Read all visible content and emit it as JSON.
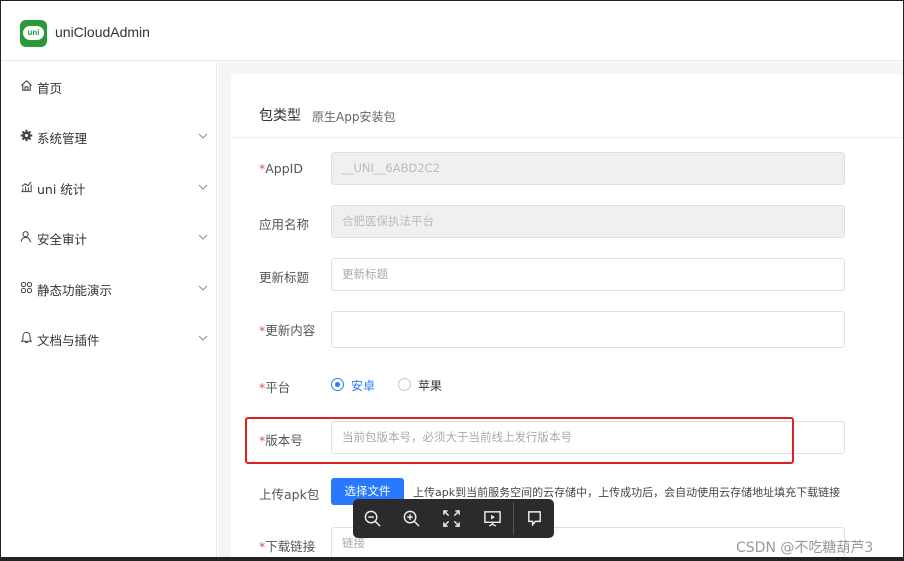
{
  "header": {
    "app_title": "uniCloudAdmin",
    "logo_text": "uni"
  },
  "sidebar": {
    "items": [
      {
        "label": "首页",
        "icon": "home-icon",
        "expandable": false
      },
      {
        "label": "系统管理",
        "icon": "gear-icon",
        "expandable": true
      },
      {
        "label": "uni 统计",
        "icon": "chart-icon",
        "expandable": true
      },
      {
        "label": "安全审计",
        "icon": "user-icon",
        "expandable": true
      },
      {
        "label": "静态功能演示",
        "icon": "grid-icon",
        "expandable": true
      },
      {
        "label": "文档与插件",
        "icon": "bell-icon",
        "expandable": true
      }
    ]
  },
  "form": {
    "package_type": {
      "label": "包类型",
      "value": "原生App安装包"
    },
    "appid": {
      "required_mark": "*",
      "label": "AppID",
      "value": "__UNI__6ABD2C2"
    },
    "app_name": {
      "label": "应用名称",
      "value": "合肥医保执法平台"
    },
    "update_title": {
      "label": "更新标题",
      "placeholder": "更新标题"
    },
    "update_content": {
      "required_mark": "*",
      "label": "更新内容",
      "value": ""
    },
    "platform": {
      "required_mark": "*",
      "label": "平台",
      "options": [
        {
          "label": "安卓",
          "checked": true
        },
        {
          "label": "苹果",
          "checked": false
        }
      ]
    },
    "version": {
      "required_mark": "*",
      "label": "版本号",
      "placeholder": "当前包版本号，必须大于当前线上发行版本号"
    },
    "upload_apk": {
      "label": "上传apk包",
      "button": "选择文件",
      "tip": "上传apk到当前服务空间的云存储中，上传成功后，会自动使用云存储地址填充下载链接"
    },
    "download_link": {
      "required_mark": "*",
      "label": "下载链接",
      "placeholder": "链接"
    }
  },
  "colors": {
    "accent": "#2979ff",
    "required": "#dd524d",
    "highlight": "#e02020",
    "logo": "#2b9939"
  },
  "viewer_toolbar": {
    "buttons": [
      "zoom-out-icon",
      "zoom-in-icon",
      "fullscreen-icon",
      "slideshow-icon",
      "comment-icon"
    ]
  },
  "watermark": "CSDN @不吃糖葫芦3"
}
